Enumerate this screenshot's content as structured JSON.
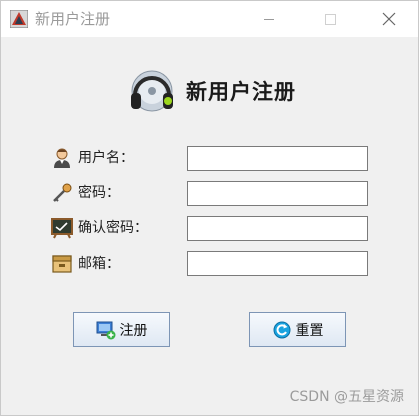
{
  "window": {
    "title": "新用户注册",
    "controls": {
      "minimize": "minimize-icon",
      "maximize": "maximize-icon",
      "close": "close-icon"
    }
  },
  "header": {
    "title": "新用户注册"
  },
  "form": {
    "rows": [
      {
        "label": "用户名：",
        "icon": "user-icon",
        "value": ""
      },
      {
        "label": "密码：",
        "icon": "key-icon",
        "value": ""
      },
      {
        "label": "确认密码：",
        "icon": "confirm-board-icon",
        "value": ""
      },
      {
        "label": "邮箱：",
        "icon": "mailbox-icon",
        "value": ""
      }
    ]
  },
  "buttons": {
    "register": {
      "label": "注册",
      "icon": "register-computer-icon"
    },
    "reset": {
      "label": "重置",
      "icon": "reset-icon"
    }
  },
  "watermark": "CSDN @五星资源",
  "colors": {
    "window_bg": "#f0f0f0",
    "button_border": "#7d95b5"
  }
}
